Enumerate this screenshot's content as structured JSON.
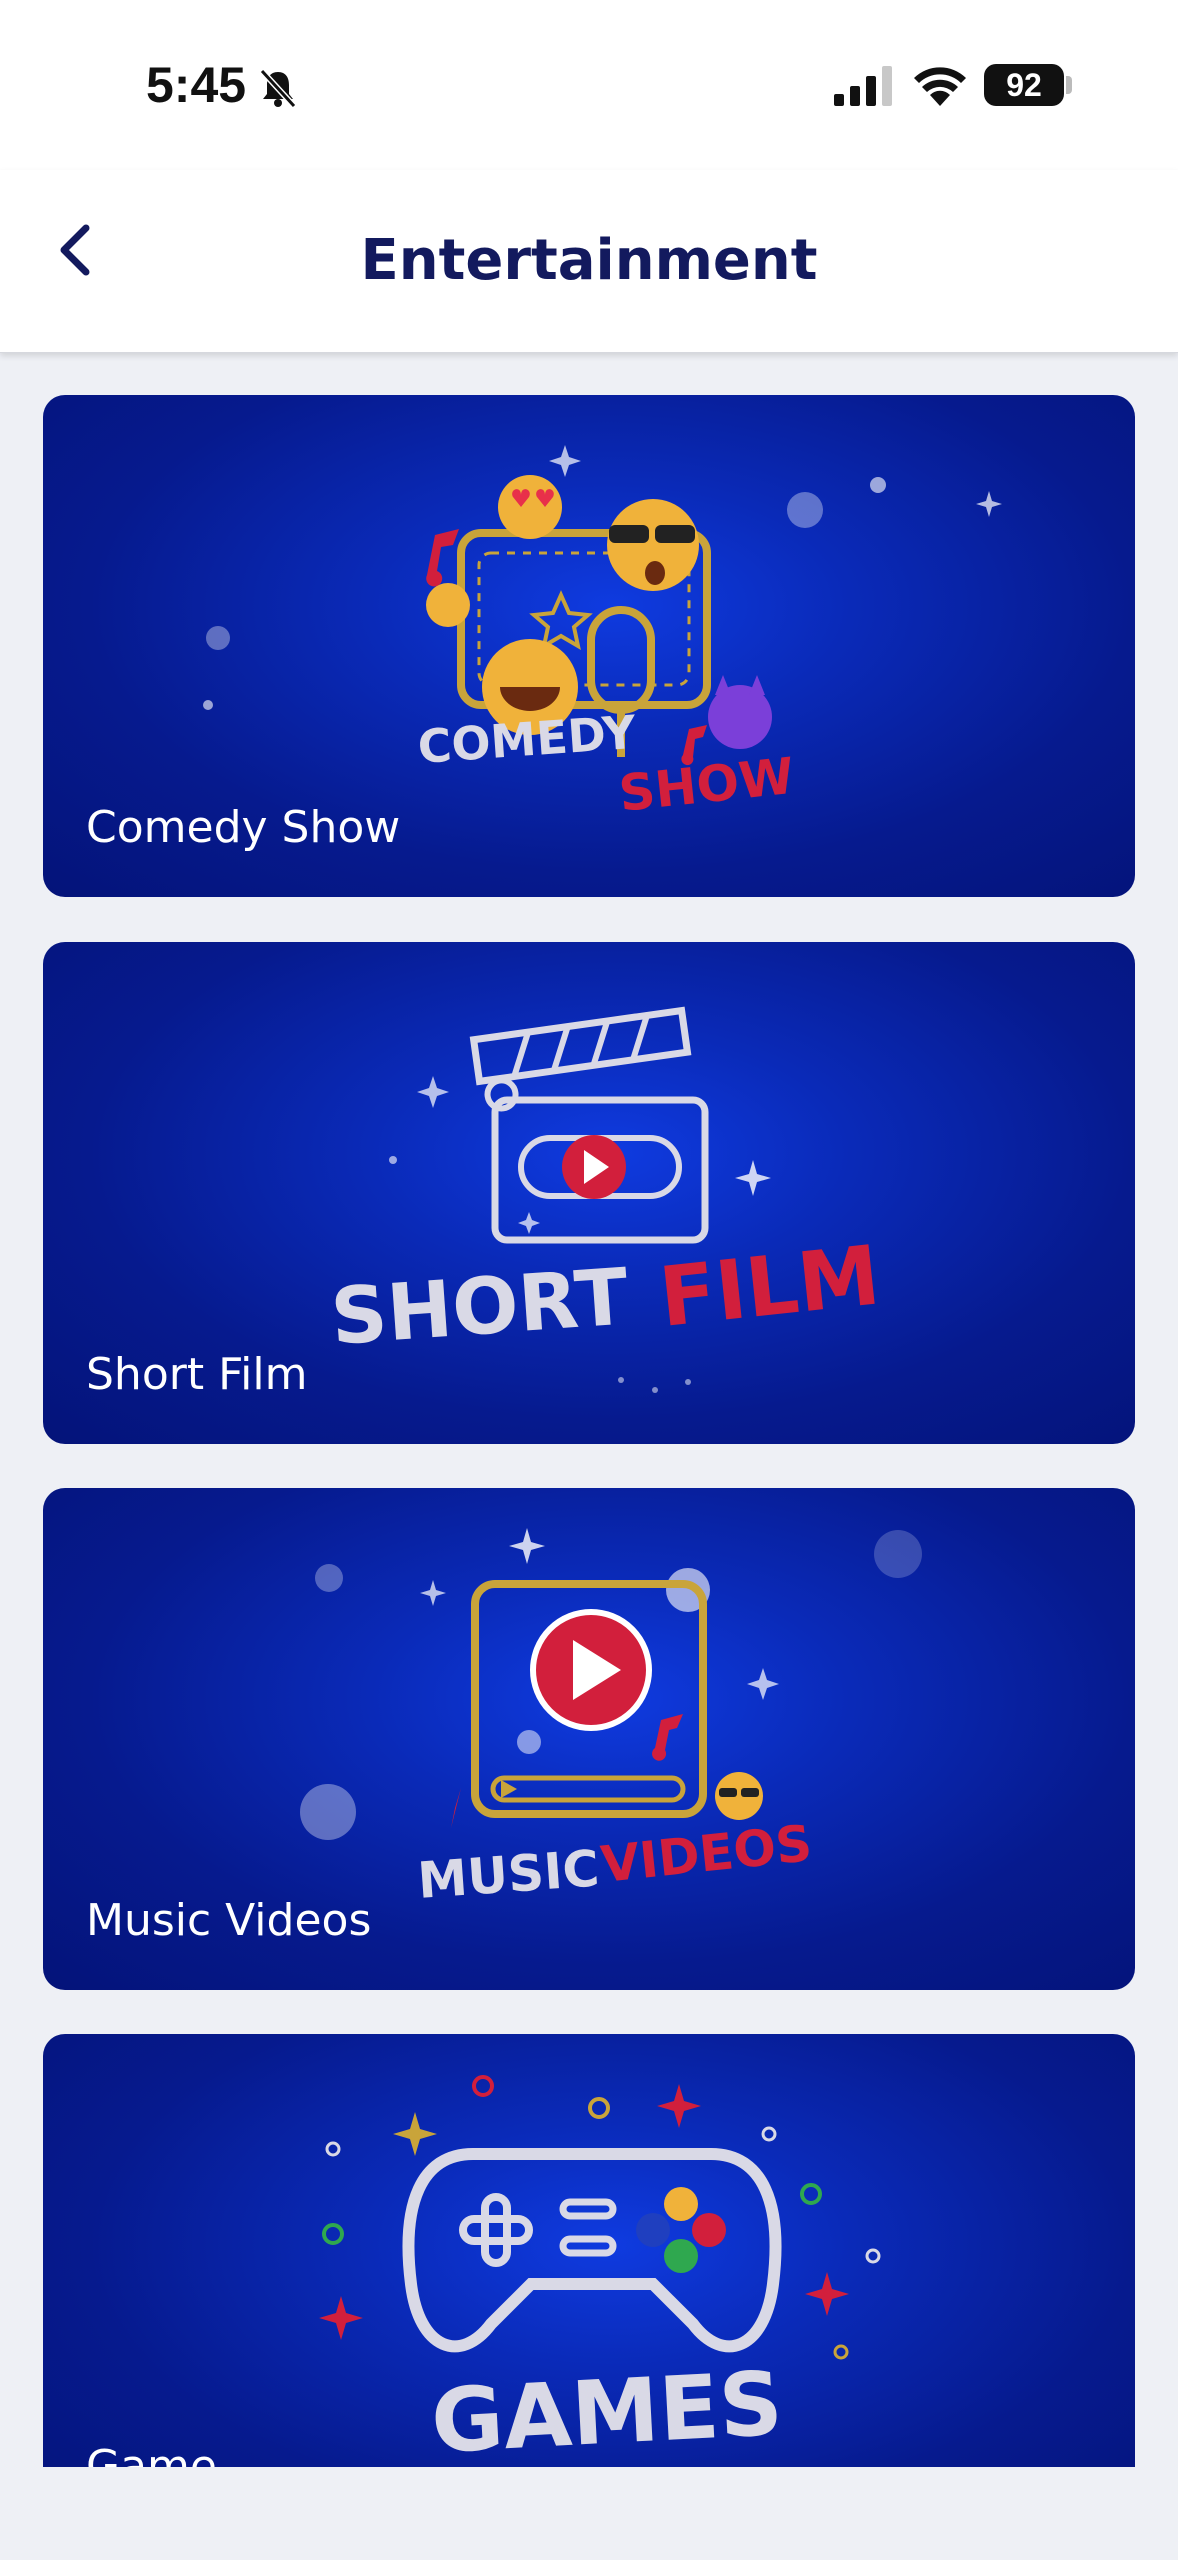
{
  "status_bar": {
    "time": "5:45",
    "battery": "92",
    "icons": [
      "bell-slash-icon",
      "cellular-signal-icon",
      "wifi-icon",
      "battery-icon"
    ]
  },
  "header": {
    "title": "Entertainment",
    "back_icon": "chevron-left-icon"
  },
  "colors": {
    "accent": "#131a5e",
    "card_blue": "#0a2ab8",
    "highlight_red": "#d21f3c",
    "gold": "#c9a43a"
  },
  "categories": [
    {
      "label": "Comedy Show",
      "art_top": "COMEDY",
      "art_bottom": "SHOW"
    },
    {
      "label": "Short Film",
      "art_top": "SHORT",
      "art_bottom": "FILM"
    },
    {
      "label": "Music Videos",
      "art_top": "MUSIC",
      "art_bottom": "VIDEOS"
    },
    {
      "label": "Game",
      "art_top": "GAMES",
      "art_bottom": ""
    }
  ]
}
